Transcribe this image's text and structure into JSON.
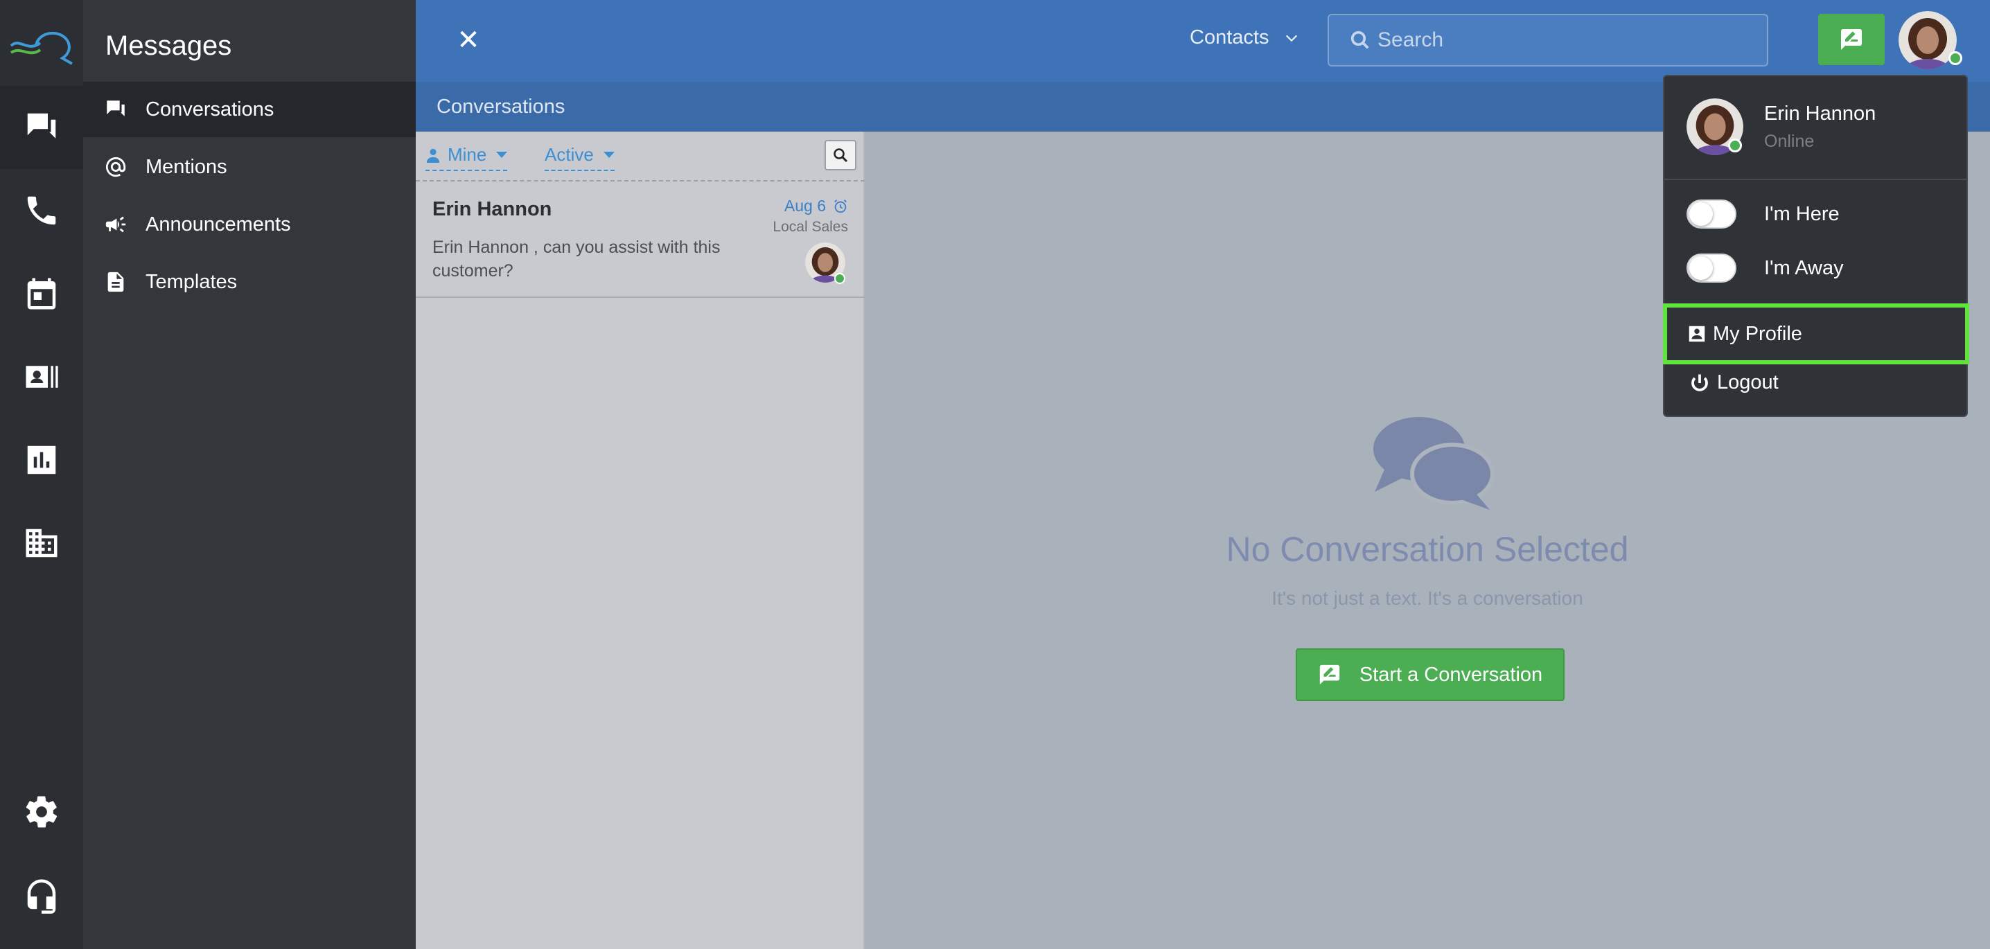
{
  "sidebar": {
    "title": "Messages",
    "items": [
      {
        "label": "Conversations",
        "icon": "conversations-icon",
        "active": true
      },
      {
        "label": "Mentions",
        "icon": "at-icon"
      },
      {
        "label": "Announcements",
        "icon": "megaphone-icon"
      },
      {
        "label": "Templates",
        "icon": "document-icon"
      }
    ]
  },
  "rail": [
    "messages-icon",
    "phone-icon",
    "calendar-icon",
    "contacts-card-icon",
    "reports-icon",
    "building-icon",
    "settings-icon",
    "support-headset-icon"
  ],
  "topbar": {
    "close": "✕",
    "contacts_label": "Contacts",
    "search_placeholder": "Search"
  },
  "subbar": {
    "title": "Conversations"
  },
  "filters": {
    "mine": "Mine",
    "active": "Active"
  },
  "conversations": [
    {
      "name": "Erin Hannon",
      "preview": "Erin Hannon , can you assist with this customer?",
      "date": "Aug 6",
      "department": "Local Sales"
    }
  ],
  "empty_state": {
    "title": "No Conversation Selected",
    "subtitle": "It's not just a text. It's a conversation",
    "button": "Start a Conversation"
  },
  "user_menu": {
    "name": "Erin Hannon",
    "status": "Online",
    "toggles": [
      {
        "label": "I'm Here",
        "on": false
      },
      {
        "label": "I'm Away",
        "on": false
      }
    ],
    "my_profile": "My Profile",
    "logout": "Logout"
  },
  "colors": {
    "topbar": "#3e73b8",
    "accent_green": "#4cae53",
    "highlight": "#62e23c",
    "link_blue": "#3c8fd1"
  }
}
